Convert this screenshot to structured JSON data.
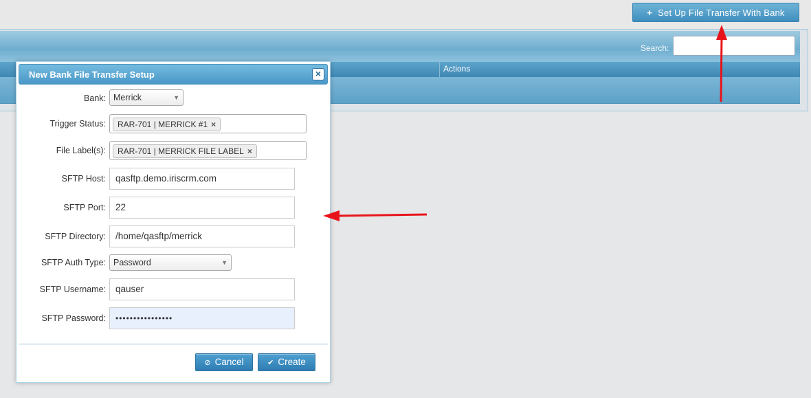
{
  "toolbar": {
    "setup_button_label": "Set Up File Transfer With Bank",
    "setup_button_icon": "plus-icon"
  },
  "grid": {
    "search_label": "Search:",
    "columns": [
      "Actions"
    ]
  },
  "modal": {
    "title": "New Bank File Transfer Setup",
    "close_icon": "close-icon",
    "fields": {
      "bank": {
        "label": "Bank:",
        "value": "Merrick"
      },
      "trigger_status": {
        "label": "Trigger Status:",
        "tag": "RAR-701 | MERRICK #1"
      },
      "file_labels": {
        "label": "File Label(s):",
        "tag": "RAR-701 | MERRICK FILE LABEL"
      },
      "sftp_host": {
        "label": "SFTP Host:",
        "value": "qasftp.demo.iriscrm.com"
      },
      "sftp_port": {
        "label": "SFTP Port:",
        "value": "22"
      },
      "sftp_directory": {
        "label": "SFTP Directory:",
        "value": "/home/qasftp/merrick"
      },
      "sftp_auth_type": {
        "label": "SFTP Auth Type:",
        "value": "Password"
      },
      "sftp_username": {
        "label": "SFTP Username:",
        "value": "qauser"
      },
      "sftp_password": {
        "label": "SFTP Password:",
        "value": "••••••••••••••••"
      }
    },
    "buttons": {
      "cancel": "Cancel",
      "create": "Create"
    }
  },
  "colors": {
    "accent": "#3f8fbf",
    "annotation_arrow": "#e8141b"
  }
}
